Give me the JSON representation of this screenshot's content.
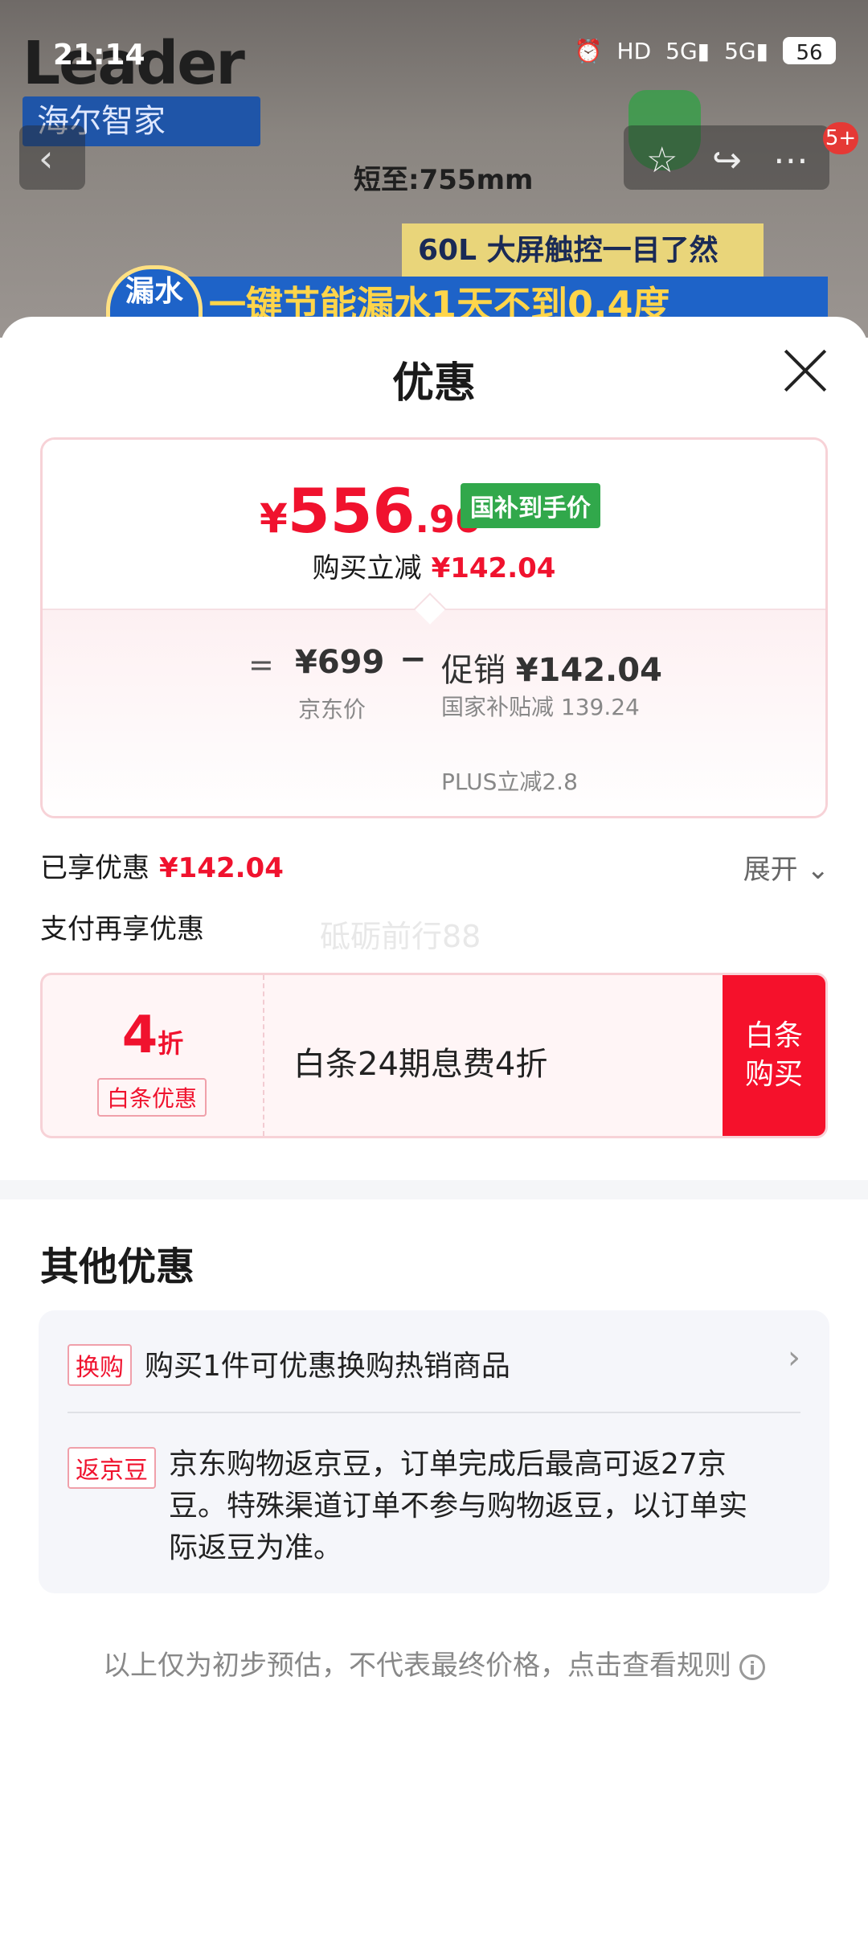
{
  "status": {
    "time": "21:14",
    "icons": [
      "alarm-icon",
      "hd-icon",
      "5g-signal-icon",
      "5g-signal-icon"
    ],
    "battery": "56"
  },
  "background": {
    "brand": "Leader",
    "brand_sub": "海尔智家",
    "dimension": "短至:755mm",
    "banner1": "60L 大屏触控一目了然",
    "banner2": "一键节能漏水1天不到0.4度",
    "round_badge": "漏水",
    "notification_count": "5+"
  },
  "sheet": {
    "title": "优惠",
    "price": {
      "currency": "¥",
      "int": "556",
      "dec": ".96",
      "tag": "国补到手价"
    },
    "reduce_label": "购买立减",
    "reduce_amount": "¥142.04",
    "breakdown": {
      "eq": "=",
      "jd_price": "¥699",
      "jd_label": "京东价",
      "minus": "−",
      "promo_label": "促销",
      "promo_amount": "¥142.04",
      "national_subsidy": "国家补贴减 139.24",
      "plus_reduce": "PLUS立减2.8"
    },
    "enjoyed_label": "已享优惠",
    "enjoyed_amount": "¥142.04",
    "expand": "展开",
    "pay_more": "支付再享优惠",
    "watermark": "砥砺前行88",
    "baitiao": {
      "discount_num": "4",
      "discount_unit": "折",
      "tag": "白条优惠",
      "text": "白条24期息费4折",
      "buy_line1": "白条",
      "buy_line2": "购买"
    },
    "other_title": "其他优惠",
    "other": [
      {
        "tag": "换购",
        "text": "购买1件可优惠换购热销商品"
      },
      {
        "tag": "返京豆",
        "text": "京东购物返京豆，订单完成后最高可返27京豆。特殊渠道订单不参与购物返豆，以订单实际返豆为准。"
      }
    ],
    "footnote": "以上仅为初步预估，不代表最终价格，点击查看规则"
  }
}
